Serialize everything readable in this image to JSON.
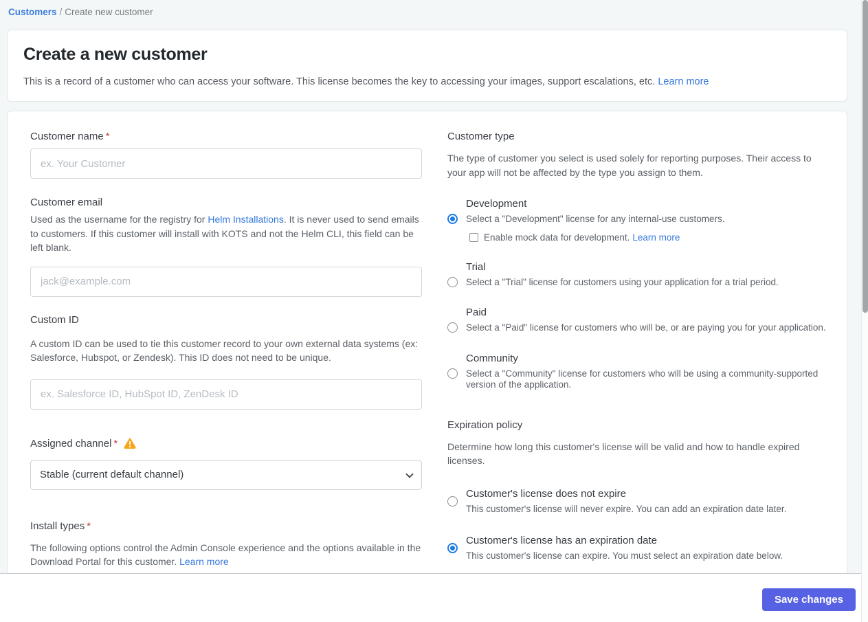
{
  "breadcrumb": {
    "link": "Customers",
    "separator": "/",
    "current": "Create new customer"
  },
  "header": {
    "title": "Create a new customer",
    "description": "This is a record of a customer who can access your software. This license becomes the key to accessing your images, support escalations, etc.",
    "learn_more": "Learn more"
  },
  "form": {
    "customer_name": {
      "label": "Customer name",
      "required_marker": "*",
      "placeholder": "ex. Your Customer",
      "value": ""
    },
    "customer_email": {
      "label": "Customer email",
      "description_before_link": "Used as the username for the registry for ",
      "link": "Helm Installations",
      "description_after_link": ". It is never used to send emails to customers. If this customer will install with KOTS and not the Helm CLI, this field can be left blank.",
      "placeholder": "jack@example.com",
      "value": ""
    },
    "custom_id": {
      "label": "Custom ID",
      "description": "A custom ID can be used to tie this customer record to your own external data systems (ex: Salesforce, Hubspot, or Zendesk). This ID does not need to be unique.",
      "placeholder": "ex. Salesforce ID, HubSpot ID, ZenDesk ID",
      "value": ""
    },
    "assigned_channel": {
      "label": "Assigned channel",
      "required_marker": "*",
      "warning_icon": "warning-triangle",
      "selected_option": "Stable (current default channel)"
    },
    "install_types": {
      "label": "Install types",
      "required_marker": "*",
      "description": "The following options control the Admin Console experience and the options available in the Download Portal for this customer.",
      "learn_more": "Learn more"
    }
  },
  "customer_type": {
    "heading": "Customer type",
    "description": "The type of customer you select is used solely for reporting purposes. Their access to your app will not be affected by the type you assign to them.",
    "options": [
      {
        "label": "Development",
        "description": "Select a \"Development\" license for any internal-use customers.",
        "selected": true,
        "checkbox": {
          "label": "Enable mock data for development.",
          "learn_more": "Learn more",
          "checked": false
        }
      },
      {
        "label": "Trial",
        "description": "Select a \"Trial\" license for customers using your application for a trial period.",
        "selected": false
      },
      {
        "label": "Paid",
        "description": "Select a \"Paid\" license for customers who will be, or are paying you for your application.",
        "selected": false
      },
      {
        "label": "Community",
        "description": "Select a \"Community\" license for customers who will be using a community-supported version of the application.",
        "selected": false
      }
    ]
  },
  "expiration_policy": {
    "heading": "Expiration policy",
    "description": "Determine how long this customer's license will be valid and how to handle expired licenses.",
    "options": [
      {
        "label": "Customer's license does not expire",
        "description": "This customer's license will never expire. You can add an expiration date later.",
        "selected": false
      },
      {
        "label": "Customer's license has an expiration date",
        "description": "This customer's license can expire. You must select an expiration date below.",
        "selected": true
      }
    ]
  },
  "footer": {
    "save_button": "Save changes"
  },
  "colors": {
    "accent_blue_link": "#3578dc",
    "radio_selected_blue": "#1b7ce4",
    "save_button_indigo": "#5661e4",
    "required_red": "#c2403a",
    "warning_amber": "#f8a51b",
    "page_background": "#f4f7f8"
  }
}
